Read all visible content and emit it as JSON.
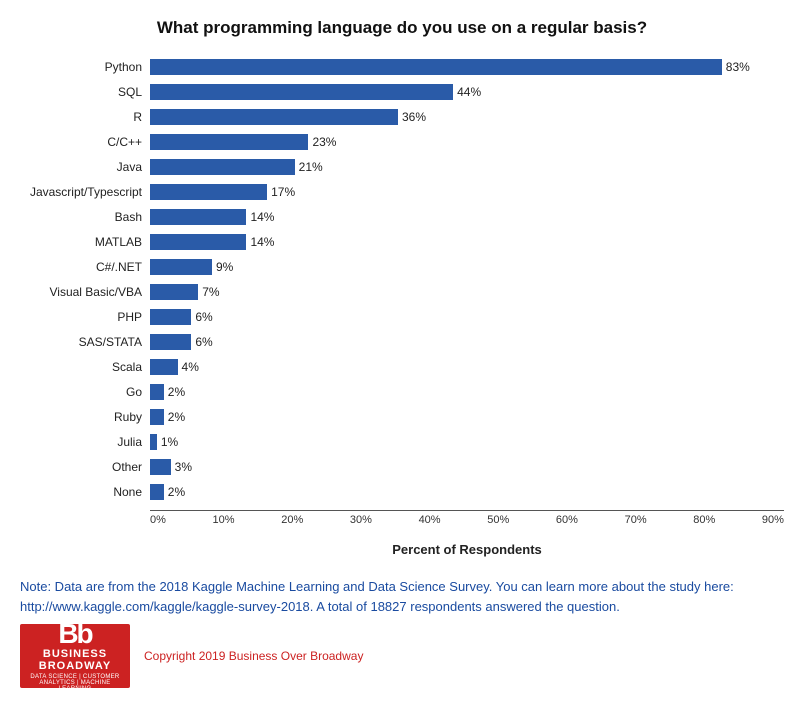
{
  "title": "What programming language do you use on a regular basis?",
  "bars": [
    {
      "label": "Python",
      "value": 83,
      "display": "83%"
    },
    {
      "label": "SQL",
      "value": 44,
      "display": "44%"
    },
    {
      "label": "R",
      "value": 36,
      "display": "36%"
    },
    {
      "label": "C/C++",
      "value": 23,
      "display": "23%"
    },
    {
      "label": "Java",
      "value": 21,
      "display": "21%"
    },
    {
      "label": "Javascript/Typescript",
      "value": 17,
      "display": "17%"
    },
    {
      "label": "Bash",
      "value": 14,
      "display": "14%"
    },
    {
      "label": "MATLAB",
      "value": 14,
      "display": "14%"
    },
    {
      "label": "C#/.NET",
      "value": 9,
      "display": "9%"
    },
    {
      "label": "Visual Basic/VBA",
      "value": 7,
      "display": "7%"
    },
    {
      "label": "PHP",
      "value": 6,
      "display": "6%"
    },
    {
      "label": "SAS/STATA",
      "value": 6,
      "display": "6%"
    },
    {
      "label": "Scala",
      "value": 4,
      "display": "4%"
    },
    {
      "label": "Go",
      "value": 2,
      "display": "2%"
    },
    {
      "label": "Ruby",
      "value": 2,
      "display": "2%"
    },
    {
      "label": "Julia",
      "value": 1,
      "display": "1%"
    },
    {
      "label": "Other",
      "value": 3,
      "display": "3%"
    },
    {
      "label": "None",
      "value": 2,
      "display": "2%"
    }
  ],
  "xaxis": {
    "max": 90,
    "ticks": [
      "0%",
      "10%",
      "20%",
      "30%",
      "40%",
      "50%",
      "60%",
      "70%",
      "80%",
      "90%"
    ],
    "label": "Percent of Respondents"
  },
  "footnote": "Note: Data are from the 2018 Kaggle Machine Learning and Data Science Survey. You can learn more about the study here: http://www.kaggle.com/kaggle/kaggle-survey-2018.  A total of 18827 respondents answered the question.",
  "logo": {
    "letters": "Bb",
    "line1": "BUSINESS",
    "line2": "BROADWAY",
    "tagline": "DATA SCIENCE | CUSTOMER ANALYTICS | MACHINE LEARNING"
  },
  "copyright": "Copyright 2019 Business Over Broadway"
}
